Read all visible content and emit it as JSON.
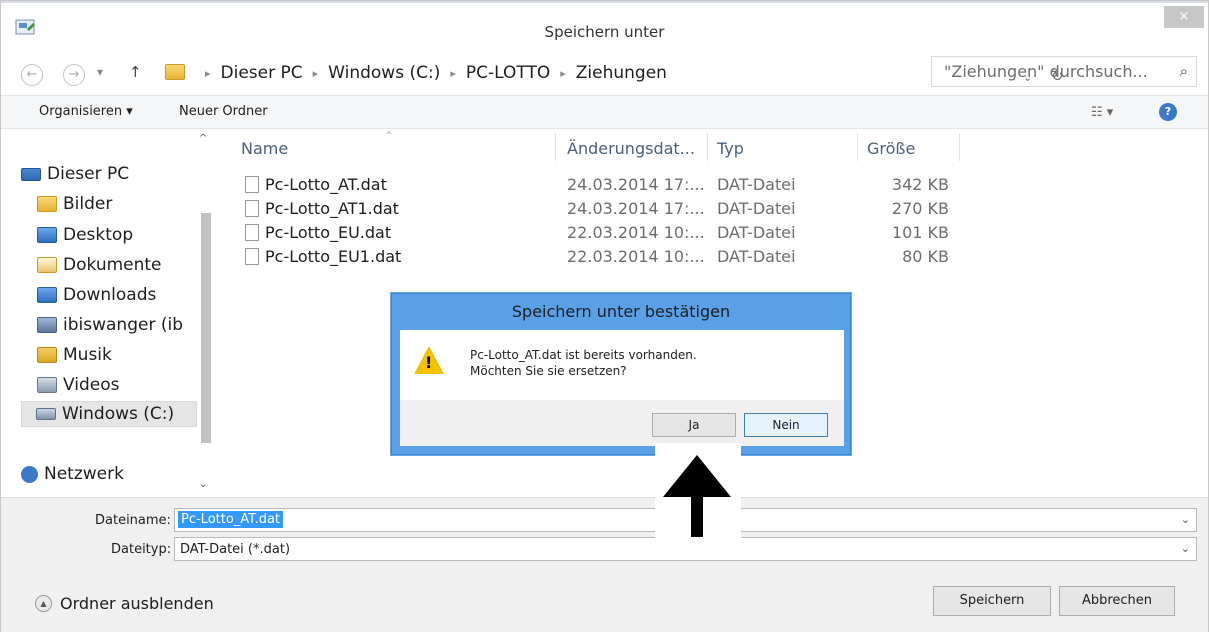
{
  "window": {
    "title": "Speichern unter",
    "close_label": "×"
  },
  "nav": {
    "back_glyph": "←",
    "forward_glyph": "→",
    "dropdown_glyph": "▾",
    "up_glyph": "↑"
  },
  "address": {
    "crumbs": [
      "Dieser PC",
      "Windows (C:)",
      "PC-LOTTO",
      "Ziehungen"
    ],
    "separator": "▸",
    "dropdown_glyph": "⌄",
    "refresh_glyph": "↻"
  },
  "search": {
    "placeholder": "\"Ziehungen\" durchsuch...",
    "icon_glyph": "⌕"
  },
  "toolbar": {
    "organize_label": "Organisieren ▾",
    "new_folder_label": "Neuer Ordner",
    "view_glyph": "☷ ▾",
    "help_glyph": "?"
  },
  "sidebar": {
    "items": [
      {
        "label": "Dieser PC",
        "icon": "pc-icon"
      },
      {
        "label": "Bilder",
        "icon": "pictures-folder-icon"
      },
      {
        "label": "Desktop",
        "icon": "desktop-folder-icon"
      },
      {
        "label": "Dokumente",
        "icon": "documents-folder-icon"
      },
      {
        "label": "Downloads",
        "icon": "downloads-folder-icon"
      },
      {
        "label": "ibiswanger (ib",
        "icon": "network-user-icon"
      },
      {
        "label": "Musik",
        "icon": "music-folder-icon"
      },
      {
        "label": "Videos",
        "icon": "videos-folder-icon"
      },
      {
        "label": "Windows (C:)",
        "icon": "drive-icon"
      },
      {
        "label": "Netzwerk",
        "icon": "network-icon"
      }
    ],
    "scroll_up": "^",
    "scroll_down": "⌄"
  },
  "files": {
    "columns": [
      "Name",
      "Änderungsdat...",
      "Typ",
      "Größe"
    ],
    "sort_glyph": "^",
    "rows": [
      {
        "name": "Pc-Lotto_AT.dat",
        "date": "24.03.2014 17:...",
        "type": "DAT-Datei",
        "size": "342 KB"
      },
      {
        "name": "Pc-Lotto_AT1.dat",
        "date": "24.03.2014 17:...",
        "type": "DAT-Datei",
        "size": "270 KB"
      },
      {
        "name": "Pc-Lotto_EU.dat",
        "date": "22.03.2014 10:...",
        "type": "DAT-Datei",
        "size": "101 KB"
      },
      {
        "name": "Pc-Lotto_EU1.dat",
        "date": "22.03.2014 10:...",
        "type": "DAT-Datei",
        "size": "80 KB"
      }
    ]
  },
  "bottom": {
    "filename_label": "Dateiname:",
    "filename_value": "Pc-Lotto_AT.dat",
    "filetype_label": "Dateityp:",
    "filetype_value": "DAT-Datei (*.dat)",
    "dropdown_glyph": "⌄",
    "hide_folders_label": "Ordner ausblenden",
    "hide_glyph": "▲",
    "save_label": "Speichern",
    "cancel_label": "Abbrechen"
  },
  "dialog": {
    "title": "Speichern unter bestätigen",
    "message_line1": "Pc-Lotto_AT.dat ist bereits vorhanden.",
    "message_line2": "Möchten Sie sie ersetzen?",
    "warning_glyph": "!",
    "yes_label": "Ja",
    "no_label": "Nein"
  },
  "colors": {
    "dialog_frame": "#5aa0e6",
    "selection": "#3399ff",
    "help_icon": "#3c78c8"
  }
}
